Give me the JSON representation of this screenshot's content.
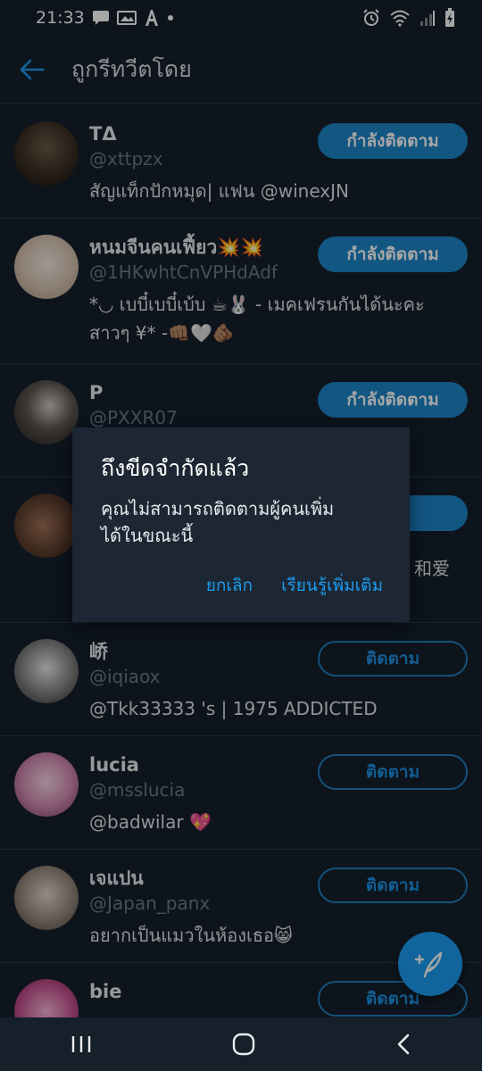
{
  "status_bar": {
    "time": "21:33",
    "icons_left": [
      "message-icon",
      "gallery-icon",
      "font-icon",
      "dot-icon"
    ],
    "icons_right": [
      "alarm-icon",
      "wifi-icon",
      "signal-icon",
      "battery-icon"
    ]
  },
  "app_bar": {
    "back_icon": "arrow-left-icon",
    "title": "ถูกรีทวีตโดย"
  },
  "users": [
    {
      "name": "TΔ",
      "handle": "@xttpzx",
      "bio_lines": [
        "สัญแท็กปักหมุด| แฟน @winexJN"
      ],
      "button": "กำลังติดตาม",
      "state": "following"
    },
    {
      "name": "หนมจีนคนเฟี้ยว💥💥",
      "handle": "@1HKwhtCnVPHdAdf",
      "bio_lines": [
        "*◡ เบบี๋เบบี๋เบ้บ ☕🐰 - เมคเฟรนกันได้นะคะ",
        "สาวๆ ¥* -👊🏽🤍🫵🏽"
      ],
      "button": "กำลังติดตาม",
      "state": "following"
    },
    {
      "name": "P",
      "handle": "@PXXR07",
      "bio_lines": [],
      "button": "กำลังติดตาม",
      "state": "following"
    },
    {
      "name": "",
      "handle": "",
      "bio_lines": [
        "和爱"
      ],
      "button": "",
      "state": "following"
    },
    {
      "name": "峤",
      "handle": "@iqiaox",
      "bio_lines": [
        "@Tkk33333 's | 1975 ADDICTED"
      ],
      "button": "ติดตาม",
      "state": "follow"
    },
    {
      "name": "lucia",
      "handle": "@msslucia",
      "bio_lines": [
        "@badwilar 💖"
      ],
      "button": "ติดตาม",
      "state": "follow"
    },
    {
      "name": "เจแปน",
      "handle": "@Japan_panx",
      "bio_lines": [
        "อยากเป็นแมวในห้องเธอ😸"
      ],
      "button": "ติดตาม",
      "state": "follow"
    },
    {
      "name": "bie",
      "handle": "",
      "bio_lines": [],
      "button": "ติดตาม",
      "state": "follow"
    }
  ],
  "dialog": {
    "title": "ถึงขีดจำกัดแล้ว",
    "message_line1": "คุณไม่สามารถติดตามผู้คนเพิ่ม",
    "message_line2": "ได้ในขณะนี้",
    "cancel": "ยกเลิก",
    "learn_more": "เรียนรู้เพิ่มเติม"
  },
  "fab": {
    "icon": "compose-feather-icon"
  },
  "nav_bar": {
    "icons": [
      "recent-apps-icon",
      "home-icon",
      "back-icon"
    ]
  },
  "colors": {
    "background": "#15202b",
    "accent": "#1d9bf0",
    "dialog": "#1c2733"
  }
}
